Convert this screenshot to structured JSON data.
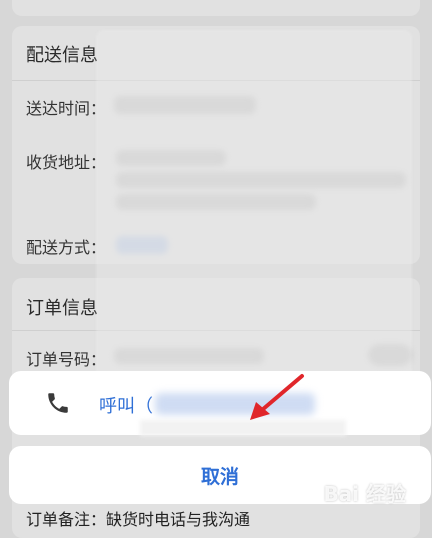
{
  "delivery": {
    "title": "配送信息",
    "time_label": "送达时间：",
    "address_label": "收货地址：",
    "method_label": "配送方式："
  },
  "order": {
    "title": "订单信息",
    "number_label": "订单号码：",
    "remark_label": "订单备注：",
    "remark_value": "缺货时电话与我沟通"
  },
  "action_sheet": {
    "call_label": "呼叫（",
    "cancel_label": "取消"
  },
  "icons": {
    "phone": "phone-icon",
    "arrow": "red-arrow"
  },
  "colors": {
    "accent": "#2f6fd6",
    "arrow": "#e0262b"
  },
  "watermark": "Bai 经验"
}
